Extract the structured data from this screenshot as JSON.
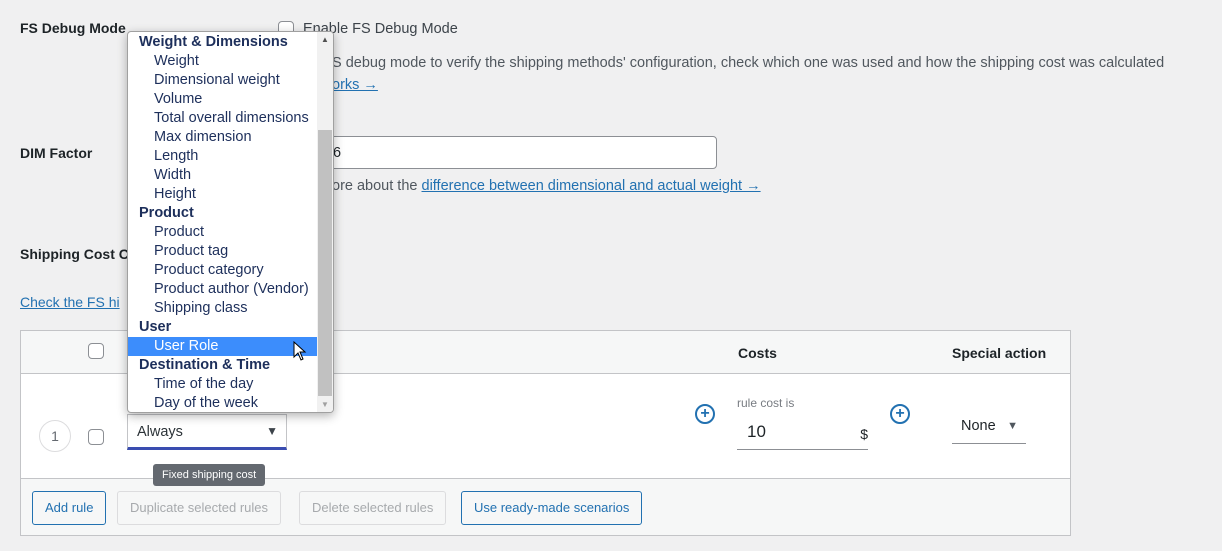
{
  "debug": {
    "label": "FS Debug Mode",
    "checkbox_label": "Enable FS Debug Mode",
    "desc_visible": "S debug mode to verify the shipping methods' configuration, check which one was used and how the shipping cost was calculated",
    "link_visible": "orks →"
  },
  "dim": {
    "label": "DIM Factor",
    "value_visible": "6",
    "desc_visible": "ore about the ",
    "link": "difference between dimensional and actual weight →"
  },
  "shipping_cost": {
    "label_visible": "Shipping Cost C",
    "link_visible": "Check the FS hi"
  },
  "dropdown": {
    "groups": [
      {
        "label": "Weight & Dimensions",
        "items": [
          "Weight",
          "Dimensional weight",
          "Volume",
          "Total overall dimensions",
          "Max dimension",
          "Length",
          "Width",
          "Height"
        ]
      },
      {
        "label": "Product",
        "items": [
          "Product",
          "Product tag",
          "Product category",
          "Product author (Vendor)",
          "Shipping class"
        ]
      },
      {
        "label": "User",
        "items": [
          "User Role"
        ]
      },
      {
        "label": "Destination & Time",
        "items": [
          "Time of the day",
          "Day of the week"
        ]
      }
    ],
    "selected": "User Role"
  },
  "table": {
    "headers": {
      "costs": "Costs",
      "special": "Special action"
    },
    "row": {
      "number": "1",
      "condition": "Always",
      "cost_label": "rule cost is",
      "cost_value": "10",
      "currency": "$",
      "special": "None"
    },
    "tooltip": "Fixed shipping cost",
    "buttons": {
      "add": "Add rule",
      "duplicate": "Duplicate selected rules",
      "delete": "Delete selected rules",
      "scenarios": "Use ready-made scenarios"
    }
  },
  "colors": {
    "accent": "#2271b1",
    "selected": "#3c8dfc"
  }
}
